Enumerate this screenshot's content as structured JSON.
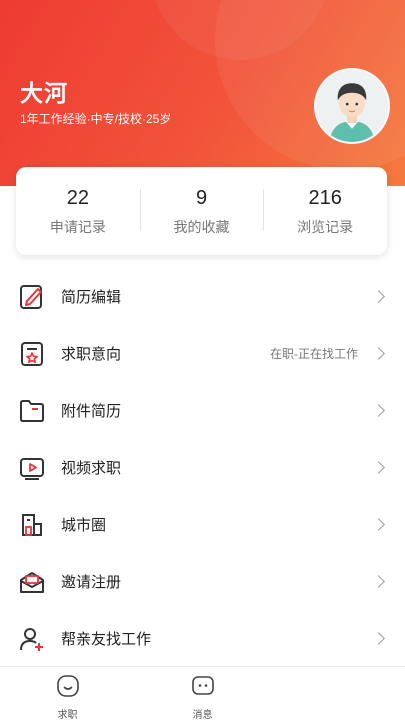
{
  "profile": {
    "name": "大河",
    "info": "1年工作经验·中专/技校·25岁"
  },
  "stats": [
    {
      "value": "22",
      "label": "申请记录"
    },
    {
      "value": "9",
      "label": "我的收藏"
    },
    {
      "value": "216",
      "label": "浏览记录"
    }
  ],
  "menu": [
    {
      "label": "简历编辑",
      "value": "",
      "icon": "resume-edit-icon"
    },
    {
      "label": "求职意向",
      "value": "在职-正在找工作",
      "icon": "job-intention-icon"
    },
    {
      "label": "附件简历",
      "value": "",
      "icon": "folder-icon"
    },
    {
      "label": "视频求职",
      "value": "",
      "icon": "video-icon"
    },
    {
      "label": "城市圈",
      "value": "",
      "icon": "building-icon"
    },
    {
      "label": "邀请注册",
      "value": "",
      "icon": "invite-mail-icon"
    },
    {
      "label": "帮亲友找工作",
      "value": "",
      "icon": "add-friend-icon"
    }
  ],
  "tabs": [
    {
      "label": "求职",
      "icon": "job-search-icon"
    },
    {
      "label": "消息",
      "icon": "message-icon"
    }
  ],
  "colors": {
    "header_start": "#ee3b33",
    "header_end": "#f47a3e",
    "icon_dark": "#333333",
    "icon_accent": "#e8343a"
  }
}
